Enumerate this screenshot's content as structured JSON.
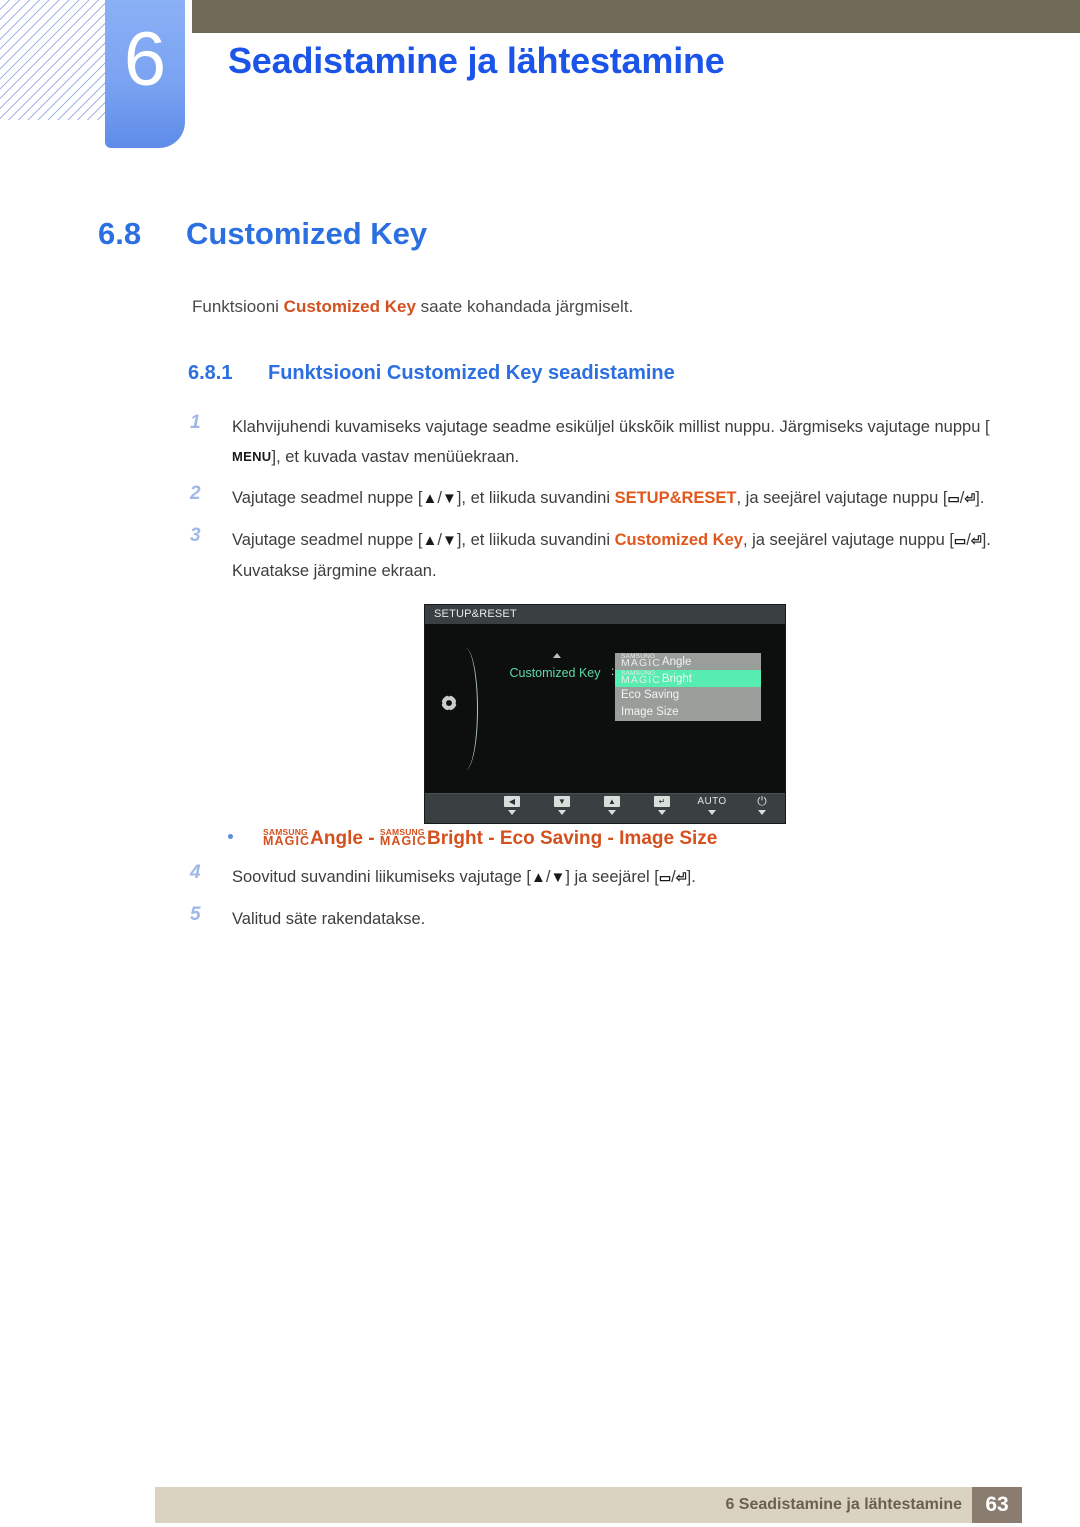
{
  "header": {
    "chapter_number": "6",
    "chapter_title": "Seadistamine ja lähtestamine"
  },
  "section": {
    "number": "6.8",
    "title": "Customized Key",
    "intro_before": "Funktsiooni ",
    "intro_highlight": "Customized Key",
    "intro_after": " saate kohandada järgmiselt."
  },
  "subsection": {
    "number": "6.8.1",
    "title": "Funktsiooni Customized Key seadistamine"
  },
  "steps": [
    {
      "n": "1",
      "p1": "Klahvijuhendi kuvamiseks vajutage seadme esiküljel ükskõik millist nuppu. Järgmiseks vajutage nuppu [",
      "kbd": "MENU",
      "p2": "], et kuvada vastav menüüekraan."
    },
    {
      "n": "2",
      "p1": "Vajutage seadmel nuppe [",
      "g1": "▲",
      "sep": "/",
      "g2": "▼",
      "p2": "], et liikuda suvandini ",
      "hl": "SETUP&RESET",
      "p3": ", ja seejärel vajutage nuppu [",
      "g3": "▭",
      "g4": "⏎",
      "p4": "]."
    },
    {
      "n": "3",
      "p1": "Vajutage seadmel nuppe [",
      "g1": "▲",
      "sep": "/",
      "g2": "▼",
      "p2": "], et liikuda suvandini ",
      "hl": "Customized Key",
      "p3": ", ja seejärel vajutage nuppu [",
      "g3": "▭",
      "g4": "⏎",
      "p4": "]. Kuvatakse järgmine ekraan."
    }
  ],
  "steps_after": [
    {
      "n": "4",
      "p1": "Soovitud suvandini liikumiseks vajutage [",
      "g1": "▲",
      "sep": "/",
      "g2": "▼",
      "p2": "] ja seejärel [",
      "g3": "▭",
      "g4": "⏎",
      "p3": "]."
    },
    {
      "n": "5",
      "p1": "Valitud säte rakendatakse."
    }
  ],
  "bullet": {
    "magic_top": "SAMSUNG",
    "magic_bottom": "MAGIC",
    "item1": "Angle",
    "dash1": " - ",
    "item2": "Bright",
    "rest": " - Eco Saving - Image Size"
  },
  "osd": {
    "title": "SETUP&RESET",
    "label": "Customized Key",
    "colon": ":",
    "menu_items": [
      {
        "magic_top": "SAMSUNG",
        "magic_bottom": "MAGIC",
        "text": "Angle",
        "highlighted": false
      },
      {
        "magic_top": "SAMSUNG",
        "magic_bottom": "MAGIC",
        "text": "Bright",
        "highlighted": true
      },
      {
        "magic_top": "",
        "magic_bottom": "",
        "text": "Eco Saving",
        "highlighted": false
      },
      {
        "magic_top": "",
        "magic_bottom": "",
        "text": "Image Size",
        "highlighted": false
      }
    ],
    "buttons": [
      {
        "glyph": "◀",
        "type": "box"
      },
      {
        "glyph": "▼",
        "type": "box"
      },
      {
        "glyph": "▲",
        "type": "box"
      },
      {
        "glyph": "↵",
        "type": "box"
      },
      {
        "glyph": "AUTO",
        "type": "auto"
      },
      {
        "glyph": "⏻",
        "type": "power"
      }
    ]
  },
  "footer": {
    "text": "6 Seadistamine ja lähtestamine",
    "page": "63"
  },
  "colors": {
    "accent_blue": "#2b6fe0",
    "title_blue": "#1a54e8",
    "orange": "#d4501e",
    "olive": "#6e6a55",
    "footer_bar": "#d9d3c0",
    "footer_page": "#8a7d70",
    "osd_highlight": "#57ecb0"
  }
}
